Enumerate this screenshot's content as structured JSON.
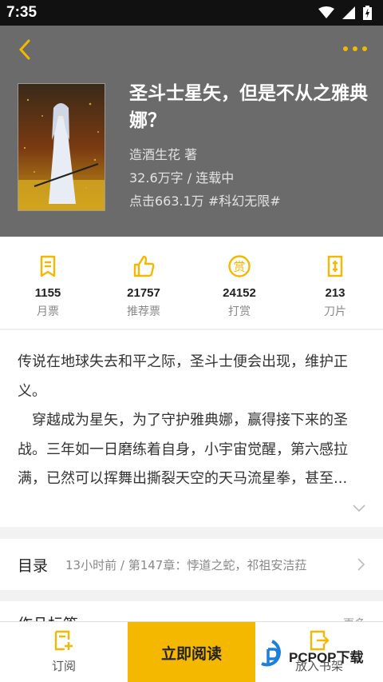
{
  "status_bar": {
    "time": "7:35"
  },
  "book": {
    "title": "圣斗士星矢，但是不从之雅典娜？",
    "author_line": "造酒生花  著",
    "words_status": "32.6万字 / 连载中",
    "clicks_tag": "点击663.1万  #科幻无限#"
  },
  "stats": [
    {
      "value": "1155",
      "label": "月票",
      "icon": "monthly-ticket-icon"
    },
    {
      "value": "21757",
      "label": "推荐票",
      "icon": "thumbs-up-icon"
    },
    {
      "value": "24152",
      "label": "打赏",
      "icon": "reward-icon"
    },
    {
      "value": "213",
      "label": "刀片",
      "icon": "blade-icon"
    }
  ],
  "description": {
    "para1": "传说在地球失去和平之际，圣斗士便会出现，维护正义。",
    "para2": "　穿越成为星矢，为了守护雅典娜，赢得接下来的圣战。三年如一日磨练着自身，小宇宙觉醒，第六感拉满，已然可以挥舞出撕裂天空的天马流星拳，甚至..."
  },
  "catalog": {
    "title": "目录",
    "latest": "13小时前 / 第147章：悖道之蛇，祁祖安洁菈"
  },
  "tags": {
    "title": "作品标签",
    "more": "更多"
  },
  "bottom": {
    "subscribe_label": "订阅",
    "read_label": "立即阅读",
    "shelf_label": "放入书架"
  },
  "watermark": {
    "text": "PCPOP下载"
  },
  "colors": {
    "accent": "#f5b800",
    "header_bg": "#6b6b6b"
  }
}
